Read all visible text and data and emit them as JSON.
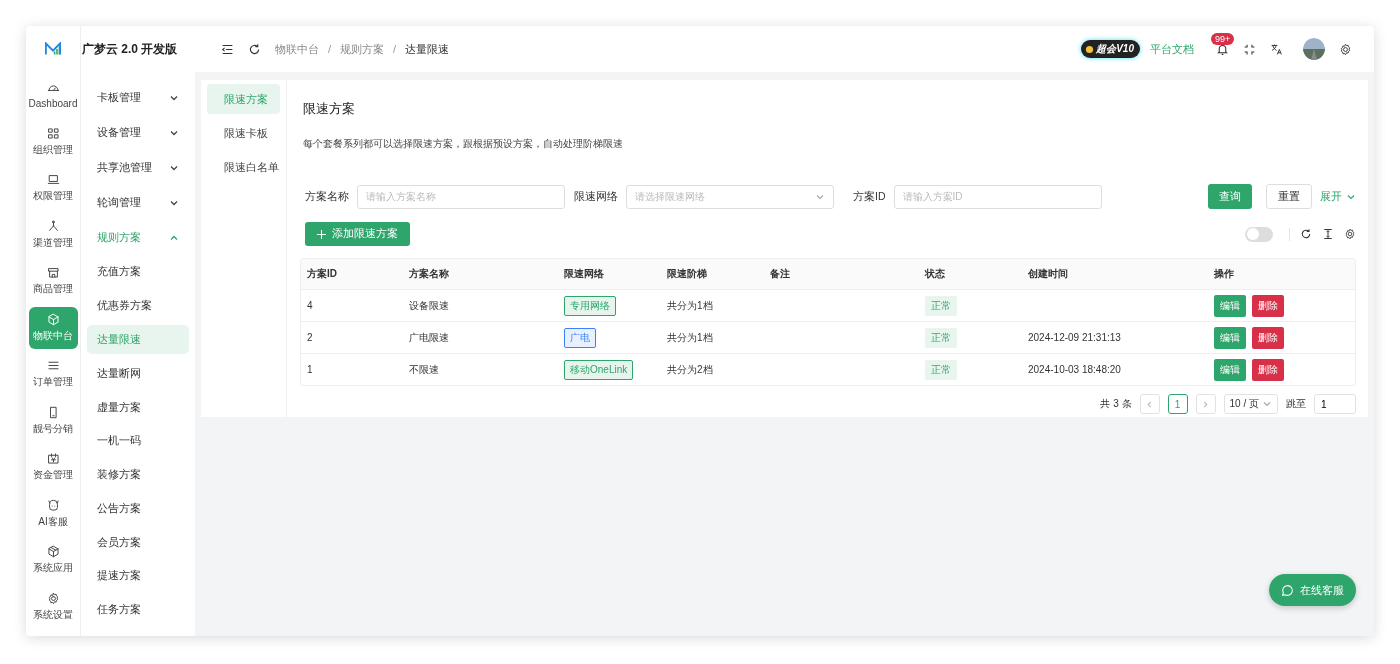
{
  "app": {
    "logo_text": "广梦云 2.0 开发版"
  },
  "breadcrumbs": [
    "物联中台",
    "规则方案",
    "达量限速"
  ],
  "breadcrumb_separator": "/",
  "header": {
    "vip_badge": "超会V10",
    "docs_link": "平台文档",
    "notification_count": "99+"
  },
  "rail": [
    {
      "label": "Dashboard",
      "selected": false
    },
    {
      "label": "组织管理",
      "selected": false
    },
    {
      "label": "权限管理",
      "selected": false
    },
    {
      "label": "渠道管理",
      "selected": false
    },
    {
      "label": "商品管理",
      "selected": false
    },
    {
      "label": "物联中台",
      "selected": true
    },
    {
      "label": "订单管理",
      "selected": false
    },
    {
      "label": "靓号分销",
      "selected": false
    },
    {
      "label": "资金管理",
      "selected": false
    },
    {
      "label": "AI客服",
      "selected": false
    },
    {
      "label": "系统应用",
      "selected": false
    },
    {
      "label": "系统设置",
      "selected": false
    }
  ],
  "submenu": [
    {
      "label": "卡板管理",
      "expanded": false,
      "selected": false
    },
    {
      "label": "设备管理",
      "expanded": false,
      "selected": false
    },
    {
      "label": "共享池管理",
      "expanded": false,
      "selected": false
    },
    {
      "label": "轮询管理",
      "expanded": false,
      "selected": false
    },
    {
      "label": "规则方案",
      "expanded": true,
      "selected": true,
      "children": [
        {
          "label": "充值方案",
          "selected": false
        },
        {
          "label": "优惠券方案",
          "selected": false
        },
        {
          "label": "达量限速",
          "selected": true
        },
        {
          "label": "达量断网",
          "selected": false
        },
        {
          "label": "虚量方案",
          "selected": false
        },
        {
          "label": "一机一码",
          "selected": false
        },
        {
          "label": "装修方案",
          "selected": false
        },
        {
          "label": "公告方案",
          "selected": false
        },
        {
          "label": "会员方案",
          "selected": false
        },
        {
          "label": "提速方案",
          "selected": false
        },
        {
          "label": "任务方案",
          "selected": false
        }
      ]
    }
  ],
  "tabs": [
    {
      "label": "限速方案",
      "selected": true
    },
    {
      "label": "限速卡板",
      "selected": false
    },
    {
      "label": "限速白名单",
      "selected": false
    }
  ],
  "page": {
    "title": "限速方案",
    "description": "每个套餐系列都可以选择限速方案，跟根据预设方案，自动处理阶梯限速"
  },
  "filters": [
    {
      "kind": "input",
      "label": "方案名称",
      "placeholder": "请输入方案名称"
    },
    {
      "kind": "select",
      "label": "限速网络",
      "placeholder": "请选择限速网络"
    },
    {
      "kind": "input",
      "label": "方案ID",
      "placeholder": "请输入方案ID"
    }
  ],
  "filter_buttons": {
    "query": "查询",
    "reset": "重置",
    "expand": "展开"
  },
  "add_button": "添加限速方案",
  "toolbar": {
    "toggle_on": false
  },
  "table": {
    "columns": [
      "方案ID",
      "方案名称",
      "限速网络",
      "限速阶梯",
      "备注",
      "状态",
      "创建时间",
      "操作"
    ],
    "rows": [
      {
        "id": "4",
        "name": "设备限速",
        "network": {
          "label": "专用网络",
          "color": "#2ea56b"
        },
        "tiers": "共分为1档",
        "status": "正常",
        "actions": [
          "编辑",
          "删除"
        ]
      },
      {
        "id": "2",
        "name": "广电限速",
        "network": {
          "label": "广电",
          "color": "#3b82f6"
        },
        "tiers": "共分为1档",
        "status": "正常",
        "created": "2024-12-09 21:31:13",
        "actions": [
          "编辑",
          "删除"
        ]
      },
      {
        "id": "1",
        "name": "不限速",
        "network": {
          "label": "移动OneLink",
          "color": "#2ea56b"
        },
        "tiers": "共分为2档",
        "status": "正常",
        "created": "2024-10-03 18:48:20",
        "actions": [
          "编辑",
          "删除"
        ]
      }
    ]
  },
  "pagination": {
    "total": "共 3 条",
    "pages": [
      {
        "label": "1",
        "selected": true
      }
    ],
    "page_size": "10 / 页",
    "jump_label": "跳至",
    "jump_value": "1"
  },
  "chat_button": "在线客服"
}
